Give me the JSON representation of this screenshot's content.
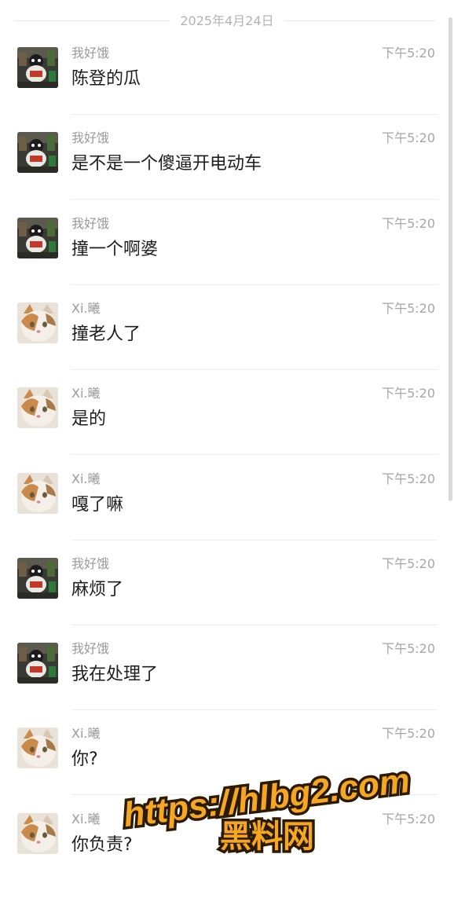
{
  "date_divider": "2025年4月24日",
  "messages": [
    {
      "sender": "我好饿",
      "time": "下午5:20",
      "text": "陈登的瓜",
      "avatar": "toy-photo-avatar"
    },
    {
      "sender": "我好饿",
      "time": "下午5:20",
      "text": "是不是一个傻逼开电动车",
      "avatar": "toy-photo-avatar"
    },
    {
      "sender": "我好饿",
      "time": "下午5:20",
      "text": "撞一个啊婆",
      "avatar": "toy-photo-avatar"
    },
    {
      "sender": "Xi.曦",
      "time": "下午5:20",
      "text": "撞老人了",
      "avatar": "cat-photo-avatar"
    },
    {
      "sender": "Xi.曦",
      "time": "下午5:20",
      "text": "是的",
      "avatar": "cat-photo-avatar"
    },
    {
      "sender": "Xi.曦",
      "time": "下午5:20",
      "text": "嘎了嘛",
      "avatar": "cat-photo-avatar"
    },
    {
      "sender": "我好饿",
      "time": "下午5:20",
      "text": "麻烦了",
      "avatar": "toy-photo-avatar"
    },
    {
      "sender": "我好饿",
      "time": "下午5:20",
      "text": "我在处理了",
      "avatar": "toy-photo-avatar"
    },
    {
      "sender": "Xi.曦",
      "time": "下午5:20",
      "text": "你?",
      "avatar": "cat-photo-avatar"
    },
    {
      "sender": "Xi.曦",
      "time": "下午5:20",
      "text": "你负责?",
      "avatar": "cat-photo-avatar"
    }
  ],
  "watermark": {
    "url": "https://hlbg2.com",
    "name": "黑料网",
    "color": "#f5a623"
  }
}
